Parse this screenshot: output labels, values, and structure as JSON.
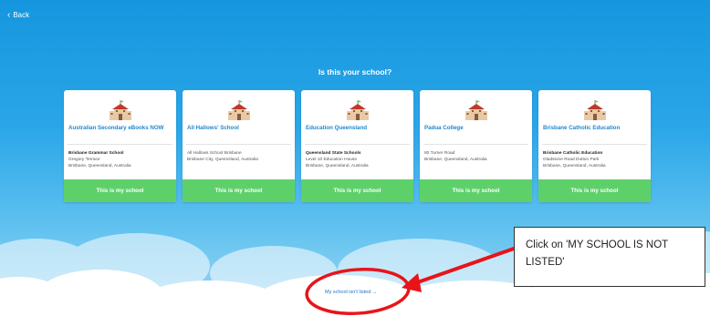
{
  "nav": {
    "back_label": "Back"
  },
  "heading": "Is this your school?",
  "schools": [
    {
      "name": "Australian Secondary eBooks NOW",
      "address": [
        "Brisbane Grammar School",
        "Gregory Terrace",
        "Brisbane, Queensland, Australia"
      ],
      "button_label": "This is my school"
    },
    {
      "name": "All Hallows' School",
      "address": [
        "All Hallows School Brisbane",
        "Brisbane City, Queensland, Australia",
        ""
      ],
      "button_label": "This is my school"
    },
    {
      "name": "Education Queensland",
      "address": [
        "Queensland State Schools",
        "Level 10 Education House",
        "Brisbane, Queensland, Australia"
      ],
      "button_label": "This is my school"
    },
    {
      "name": "Padua College",
      "address": [
        "80 Turner Road",
        "Brisbane, Queensland, Australia",
        ""
      ],
      "button_label": "This is my school"
    },
    {
      "name": "Brisbane Catholic Education",
      "address": [
        "Brisbane Catholic Education",
        "Gladstone Road Dutton Park",
        "Brisbane, Queensland, Australia"
      ],
      "button_label": "This is my school"
    }
  ],
  "not_listed_link": "My school isn't listed",
  "not_listed_arrow": "→",
  "annotation": {
    "text": "Click on 'MY SCHOOL IS NOT LISTED'"
  },
  "colors": {
    "sky_top": "#1596de",
    "sky_bottom": "#9fd9f4",
    "title_blue": "#1e88d1",
    "button_green": "#5ed06a",
    "annotation_red": "#e8141a"
  },
  "icons": {
    "back": "chevron-left-icon",
    "school": "school-building-icon",
    "link_arrow": "arrow-right-icon"
  }
}
